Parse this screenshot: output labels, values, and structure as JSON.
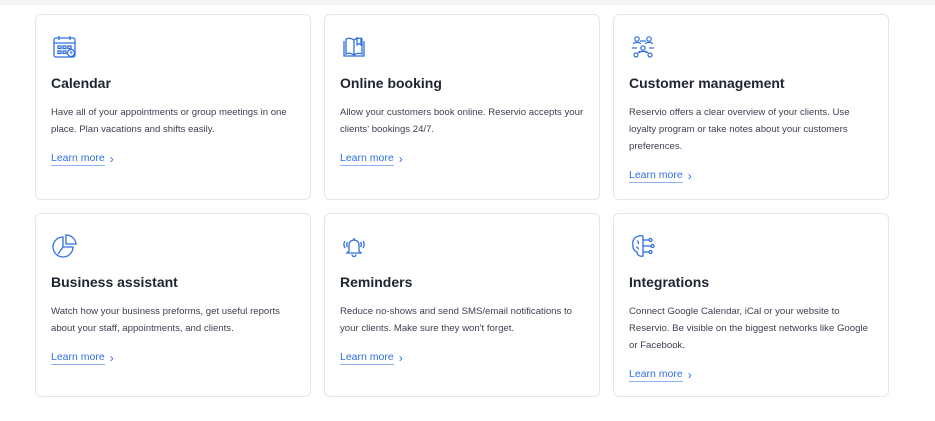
{
  "cards": [
    {
      "icon": "calendar-icon",
      "title": "Calendar",
      "description": "Have all of your appointments or group meetings in one place. Plan vacations and shifts easily.",
      "link": "Learn more"
    },
    {
      "icon": "book-icon",
      "title": "Online booking",
      "description": "Allow your customers book online. Reservio accepts your clients' bookings 24/7.",
      "link": "Learn more"
    },
    {
      "icon": "customers-icon",
      "title": "Customer management",
      "description": "Reservio offers a clear overview of your clients. Use loyalty program or take notes about your customers preferences.",
      "link": "Learn more"
    },
    {
      "icon": "pie-chart-icon",
      "title": "Business assistant",
      "description": "Watch how your business preforms, get useful reports about your staff, appointments, and clients.",
      "link": "Learn more"
    },
    {
      "icon": "bell-icon",
      "title": "Reminders",
      "description": "Reduce no-shows and send SMS/email notifications to your clients. Make sure they won't forget.",
      "link": "Learn more"
    },
    {
      "icon": "integrations-icon",
      "title": "Integrations",
      "description": "Connect Google Calendar, iCal or your website to Reservio. Be visible on the biggest networks like Google or Facebook.",
      "link": "Learn more"
    }
  ],
  "colors": {
    "accent": "#2f6fe0",
    "border": "#e3e6ec",
    "title": "#1f2430",
    "text": "#3b4150"
  }
}
